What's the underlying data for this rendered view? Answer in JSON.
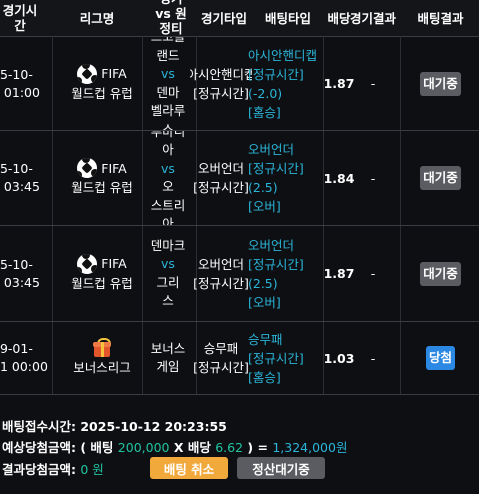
{
  "header": {
    "time_line1": "경기시",
    "time_line2": "간",
    "league": "리그명",
    "match_line1": "경기",
    "match_line2": "vs 원",
    "match_line3": "정티",
    "game_type": "경기타입",
    "bet_type": "배팅타입",
    "odds": "배당",
    "game_result": "경기결과",
    "bet_result": "배팅결과"
  },
  "rows": [
    {
      "time_line1": "25-10-",
      "time_line2": "3 01:00",
      "league_icon": "soccer-ball-icon",
      "league_line1": "FIFA",
      "league_line2": "월드컵 유럽",
      "home_line1": "스코틀",
      "home_line2": "랜드",
      "vs": "vs",
      "away_line1": "덴마",
      "away_line2": "벨라루",
      "away_line3": "스",
      "game_type_line1": "아시안핸디캡",
      "game_type_line2": "[정규시간]",
      "bet_type_line1": "아시안핸디캡",
      "bet_type_line2": "[정규시간]",
      "bet_type_line3": "(-2.0)",
      "bet_type_line4": "[홈승]",
      "odds": "1.87",
      "game_result": "-",
      "bet_result": "대기중",
      "bet_result_kind": "waiting"
    },
    {
      "time_line1": "25-10-",
      "time_line2": "3 03:45",
      "league_icon": "soccer-ball-icon",
      "league_line1": "FIFA",
      "league_line2": "월드컵 유럽",
      "home_line1": "루마니",
      "home_line2": "아",
      "vs": "vs",
      "away_line1": "오",
      "away_line2": "스트리",
      "away_line3": "아",
      "game_type_line1": "오버언더",
      "game_type_line2": "[정규시간]",
      "bet_type_line1": "오버언더",
      "bet_type_line2": "[정규시간]",
      "bet_type_line3": "(2.5)",
      "bet_type_line4": "[오버]",
      "odds": "1.84",
      "game_result": "-",
      "bet_result": "대기중",
      "bet_result_kind": "waiting"
    },
    {
      "time_line1": "25-10-",
      "time_line2": "3 03:45",
      "league_icon": "soccer-ball-icon",
      "league_line1": "FIFA",
      "league_line2": "월드컵 유럽",
      "home_line1": "덴마크",
      "vs": "vs",
      "away_line1": "그리",
      "away_line2": "스",
      "game_type_line1": "오버언더",
      "game_type_line2": "[정규시간]",
      "bet_type_line1": "오버언더",
      "bet_type_line2": "[정규시간]",
      "bet_type_line3": "(2.5)",
      "bet_type_line4": "[오버]",
      "odds": "1.87",
      "game_result": "-",
      "bet_result": "대기중",
      "bet_result_kind": "waiting"
    },
    {
      "time_line1": "99-01-",
      "time_line2": "01 00:00",
      "league_icon": "gift-box-icon",
      "league_line1": "보너스리그",
      "home_line1": "보너스",
      "home_line2": "게임",
      "game_type_line1": "승무패",
      "game_type_line2": "[정규시간]",
      "bet_type_line1": "승무패",
      "bet_type_line2": "[정규시간]",
      "bet_type_line3": "[홈승]",
      "odds": "1.03",
      "game_result": "-",
      "bet_result": "당첨",
      "bet_result_kind": "win"
    }
  ],
  "summary": {
    "bet_time_label": "배팅접수시간:",
    "bet_time_value": "2025-10-12 20:23:55",
    "expected_label": "예상당첨금액:",
    "expected_open": "( 배팅",
    "expected_bet_amount": "200,000",
    "expected_x": "X 배당",
    "expected_odds": "6.62",
    "expected_close": ") =",
    "expected_payout": "1,324,000원",
    "result_label": "결과당첨금액:",
    "result_value": "0 원",
    "cancel_button": "배팅 취소",
    "status_button": "정산대기중"
  },
  "colors": {
    "background": "#0e0f13",
    "accent_teal": "#21c4a1",
    "accent_blue": "#2bb5d8",
    "waiting_badge": "#5b5c61",
    "win_badge": "#2b88e3",
    "cancel_button": "#f2a93b"
  }
}
